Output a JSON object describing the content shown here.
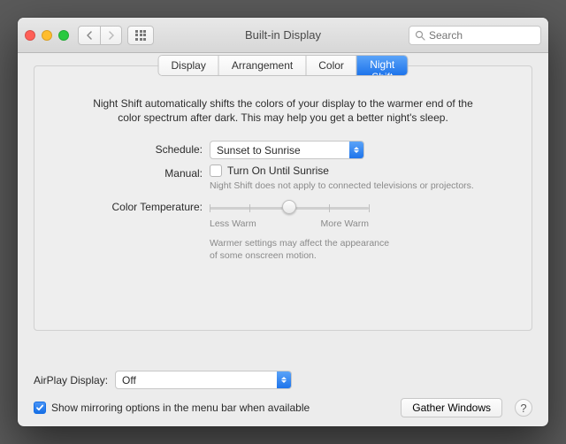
{
  "window": {
    "title": "Built-in Display"
  },
  "search": {
    "placeholder": "Search"
  },
  "tabs": {
    "display": "Display",
    "arrangement": "Arrangement",
    "color": "Color",
    "night_shift": "Night Shift"
  },
  "description": "Night Shift automatically shifts the colors of your display to the warmer end of the color spectrum after dark. This may help you get a better night's sleep.",
  "schedule": {
    "label": "Schedule:",
    "value": "Sunset to Sunrise"
  },
  "manual": {
    "label": "Manual:",
    "checkbox_label": "Turn On Until Sunrise",
    "hint": "Night Shift does not apply to connected televisions or projectors."
  },
  "temperature": {
    "label": "Color Temperature:",
    "less": "Less Warm",
    "more": "More Warm",
    "hint": "Warmer settings may affect the appearance of some onscreen motion."
  },
  "airplay": {
    "label": "AirPlay Display:",
    "value": "Off"
  },
  "mirroring": {
    "label": "Show mirroring options in the menu bar when available"
  },
  "gather": "Gather Windows",
  "help": "?"
}
